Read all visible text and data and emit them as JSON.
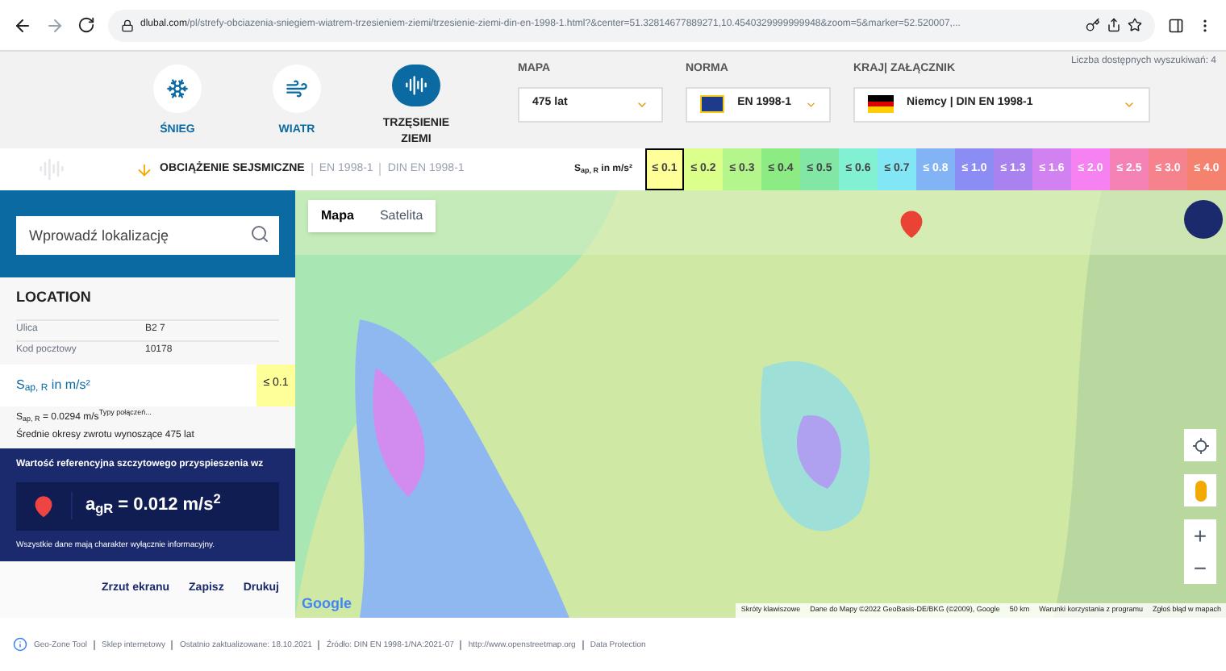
{
  "browser": {
    "url_domain": "dlubal.com",
    "url_path": "/pl/strefy-obciazenia-sniegiem-wiatrem-trzesieniem-ziemi/trzesienie-ziemi-din-en-1998-1.html?&center=51.32814677889271,10.4540329999999948&zoom=5&marker=52.520007,..."
  },
  "search_count": "Liczba dostępnych wyszukiwań: 4",
  "load_types": [
    {
      "kind": "snow",
      "label": "ŚNIEG",
      "selected": false
    },
    {
      "kind": "wind",
      "label": "WIATR",
      "selected": false
    },
    {
      "kind": "quake",
      "label": "TRZĘSIENIE ZIEMI",
      "selected": true
    }
  ],
  "selectors": [
    {
      "label": "MAPA",
      "value": "475 lat",
      "kind": "plain"
    },
    {
      "label": "NORMA",
      "value": "EN 1998-1",
      "kind": "eu"
    },
    {
      "label": "KRAJ| ZAŁĄCZNIK",
      "value": "Niemcy | DIN EN 1998-1",
      "kind": "de"
    }
  ],
  "breadcrumb": {
    "title": "OBCIĄŻENIE SEJSMICZNE",
    "parts": [
      "EN 1998-1",
      "DIN EN 1998-1"
    ]
  },
  "legend": {
    "unit": "S$_{ap, R}$ in m/s²",
    "items": [
      {
        "label": "≤ 0.1",
        "color": "#ffff99",
        "selected": true
      },
      {
        "label": "≤ 0.2",
        "color": "#dcff8c",
        "selected": false
      },
      {
        "label": "≤ 0.3",
        "color": "#b4f58c",
        "selected": false
      },
      {
        "label": "≤ 0.4",
        "color": "#8ceb82",
        "selected": false
      },
      {
        "label": "≤ 0.5",
        "color": "#82e6a5",
        "selected": false
      },
      {
        "label": "≤ 0.6",
        "color": "#82f0d2",
        "selected": false
      },
      {
        "label": "≤ 0.7",
        "color": "#82e6f5",
        "selected": false
      },
      {
        "label": "≤ 0.8",
        "color": "#82b4f5",
        "selected": false
      },
      {
        "label": "≤ 1.0",
        "color": "#8c8cf5",
        "selected": false
      },
      {
        "label": "≤ 1.3",
        "color": "#aa82f0",
        "selected": false
      },
      {
        "label": "≤ 1.6",
        "color": "#d282f0",
        "selected": false
      },
      {
        "label": "≤ 2.0",
        "color": "#f582f0",
        "selected": false
      },
      {
        "label": "≤ 2.5",
        "color": "#f582b4",
        "selected": false
      },
      {
        "label": "≤ 3.0",
        "color": "#f5828c",
        "selected": false
      },
      {
        "label": "≤ 4.0",
        "color": "#f5826e",
        "selected": false
      }
    ]
  },
  "panel": {
    "search_placeholder": "Wprowadź lokalizację",
    "location_title": "LOCATION",
    "location_rows": [
      {
        "label": "Ulica",
        "value": "B2 7"
      },
      {
        "label": "Kod pocztowy",
        "value": "10178"
      }
    ],
    "result_label": "S$_{ap, R}$ in m/s²",
    "result_badge": "≤ 0.1",
    "result_value": "S$_{ap, R}$ = 0.0294 m/s$^{Typy połączeń...}$",
    "return_period": "Średnie okresy zwrotu wynoszące 475 lat",
    "reference_title": "Wartość referencyjna szczytowego przyspieszenia wz",
    "agr": "a$_{gR}$ = 0.012 m/s$^{2}$",
    "disclaimer": "Wszystkie dane mają charakter wyłącznie informacyjny.",
    "actions": [
      "Zrzut ekranu",
      "Zapisz",
      "Drukuj"
    ]
  },
  "map": {
    "tabs": [
      {
        "label": "Mapa",
        "selected": true
      },
      {
        "label": "Satelita",
        "selected": false
      }
    ],
    "attribution": [
      "Skróty klawiszowe",
      "Dane do Mapy ©2022 GeoBasis-DE/BKG (©2009), Google",
      "50 km",
      "Warunki korzystania z programu",
      "Zgłoś błąd w mapach"
    ],
    "zoom_in": "+",
    "zoom_out": "−",
    "logo": "Google"
  },
  "footer": [
    "Geo-Zone Tool",
    "Sklep internetowy",
    "Ostatnio zaktualizowane: 18.10.2021",
    "Źródło: DIN EN 1998-1/NA:2021-07",
    "http://www.openstreetmap.org",
    "Data Protection"
  ]
}
